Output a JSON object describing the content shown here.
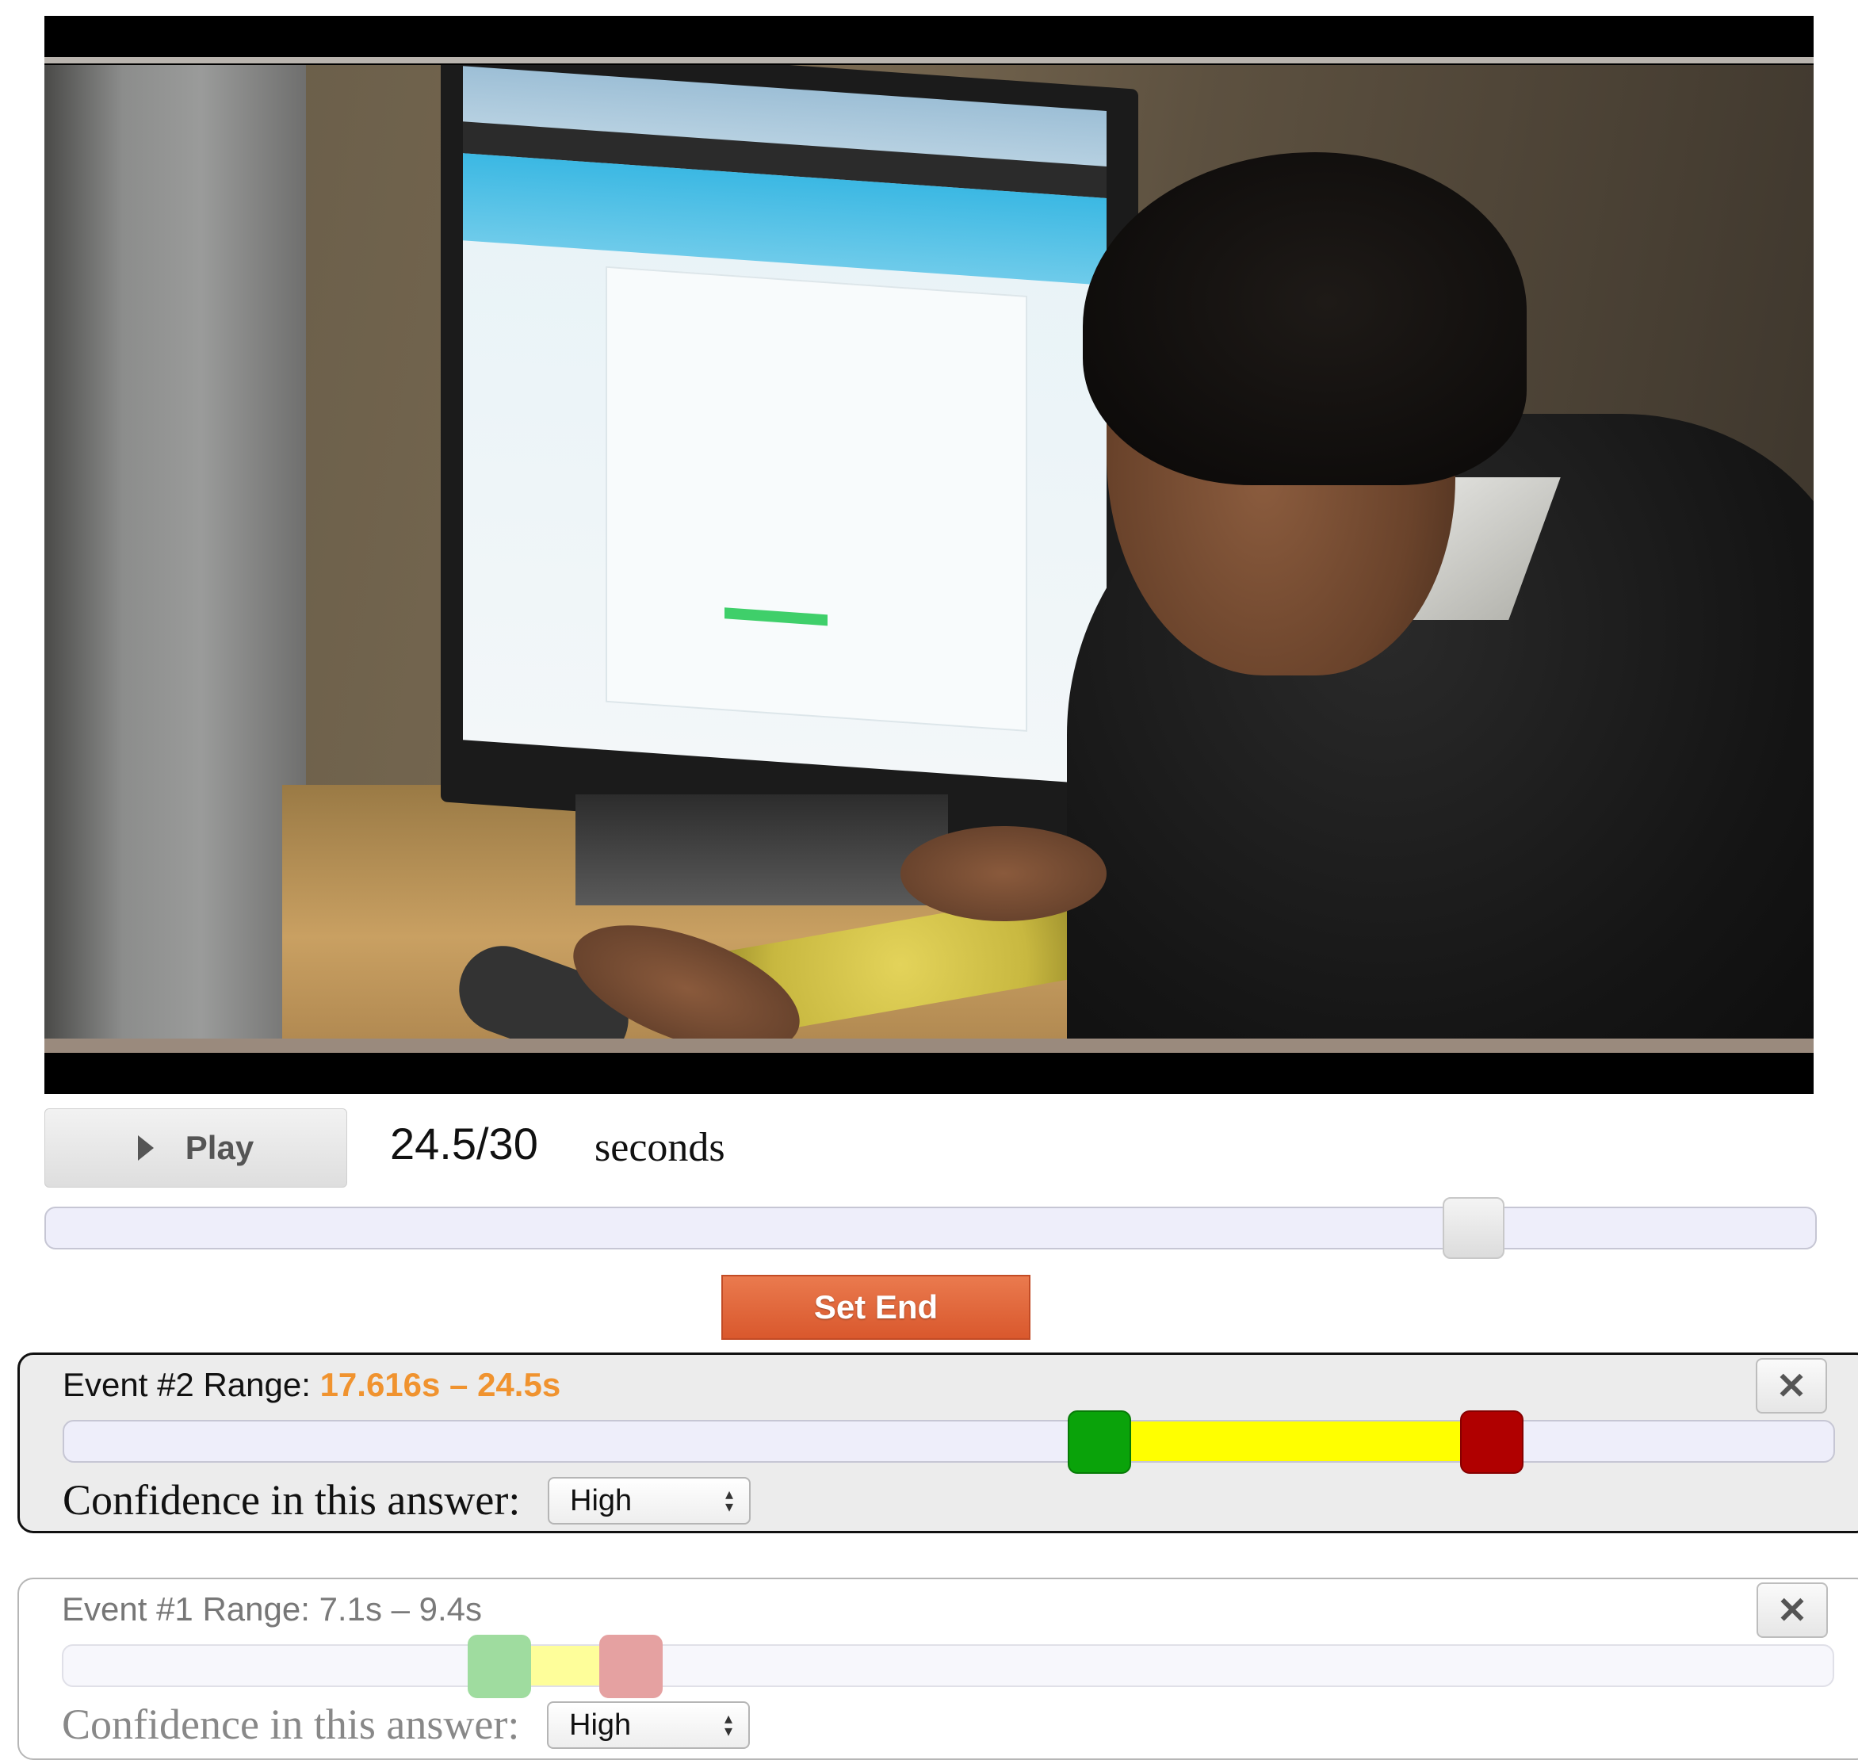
{
  "controls": {
    "play_label": "Play",
    "time_readout": "24.5/30",
    "time_unit": "seconds",
    "current_time": 24.5,
    "duration": 30,
    "set_end_label": "Set End"
  },
  "events": [
    {
      "title": "Event #2 Range: ",
      "range_text": "17.616s – 24.5s",
      "start": 17.616,
      "end": 24.5,
      "confidence_label": "Confidence in this answer:",
      "confidence_value": "High",
      "close_label": "✕",
      "active": true
    },
    {
      "title": "Event #1 Range: ",
      "range_text": "7.1s – 9.4s",
      "start": 7.1,
      "end": 9.4,
      "confidence_label": "Confidence in this answer:",
      "confidence_value": "High",
      "close_label": "✕",
      "active": false
    }
  ],
  "colors": {
    "set_end_button": "#d9582d",
    "range_start_handle": "#0aa30a",
    "range_end_handle": "#b00000",
    "range_fill": "#ffff00",
    "active_range_text": "#f0932f"
  },
  "icons": {
    "play": "play-triangle-icon",
    "close": "close-icon",
    "select": "updown-arrows-icon"
  }
}
